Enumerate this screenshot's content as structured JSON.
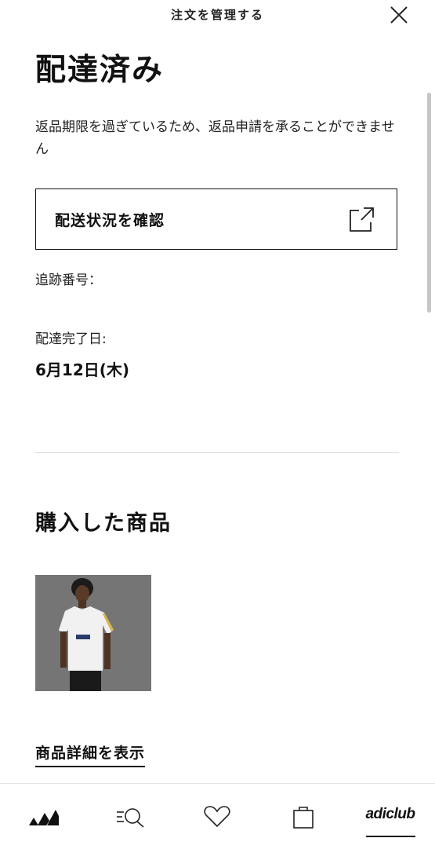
{
  "header": {
    "title": "注文を管理する"
  },
  "order": {
    "status": "配達済み",
    "notice": "返品期限を過ぎているため、返品申請を承ることができません",
    "track_button_label": "配送状況を確認",
    "tracking_label": "追跡番号：",
    "delivered_label": "配達完了日:",
    "delivered_date": "6月12日(木)"
  },
  "products": {
    "section_title": "購入した商品",
    "view_details_label": "商品詳細を表示"
  },
  "bottom_nav": {
    "items": [
      "brand-logo",
      "search",
      "wishlist",
      "bag",
      "adiclub"
    ],
    "club_label": "adiclub",
    "active": "adiclub"
  },
  "colors": {
    "text": "#111111",
    "divider": "#d7d7d7",
    "background": "#ffffff"
  }
}
